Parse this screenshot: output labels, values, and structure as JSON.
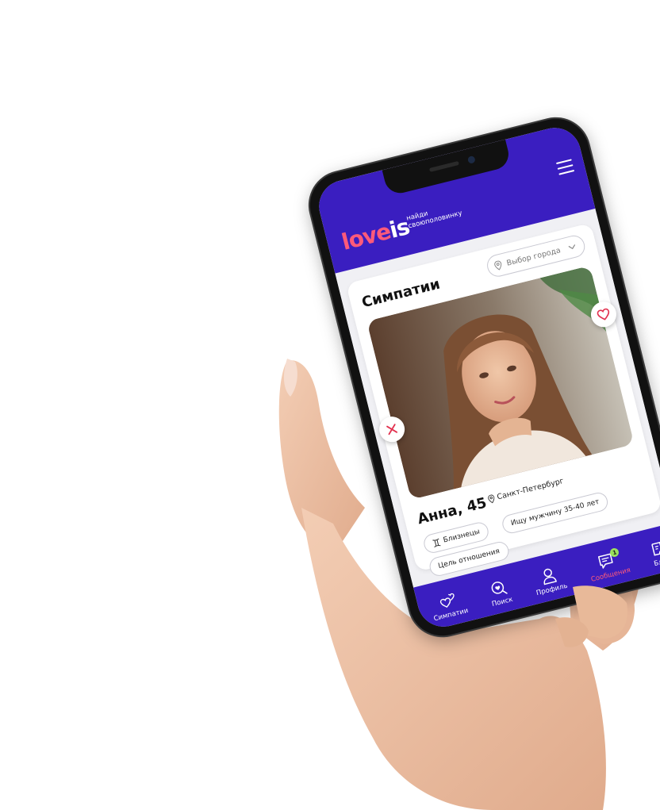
{
  "header": {
    "logo_part1": "l",
    "logo_heart": "o",
    "logo_part2": "ve",
    "logo_part3": "is",
    "tagline": "найди своюполовинку"
  },
  "page": {
    "title": "Симпатии",
    "city_placeholder": "Выбор города"
  },
  "profile": {
    "name_age": "Анна, 45",
    "city": "Санкт-Петербург",
    "tags": {
      "zodiac": "Близнецы",
      "looking_for": "Ищу мужчину 35-40 лет",
      "goal": "Цель отношения"
    }
  },
  "nav": {
    "items": [
      {
        "label": "Симпатии",
        "icon": "hearts-icon"
      },
      {
        "label": "Поиск",
        "icon": "search-heart-icon"
      },
      {
        "label": "Профиль",
        "icon": "user-icon"
      },
      {
        "label": "Сообщения",
        "icon": "chat-icon",
        "badge": "1",
        "active": true
      },
      {
        "label": "Блог",
        "icon": "edit-icon"
      }
    ]
  },
  "colors": {
    "brand": "#3a1ec0",
    "accent": "#ff5a7a",
    "badge": "#9be15d"
  }
}
